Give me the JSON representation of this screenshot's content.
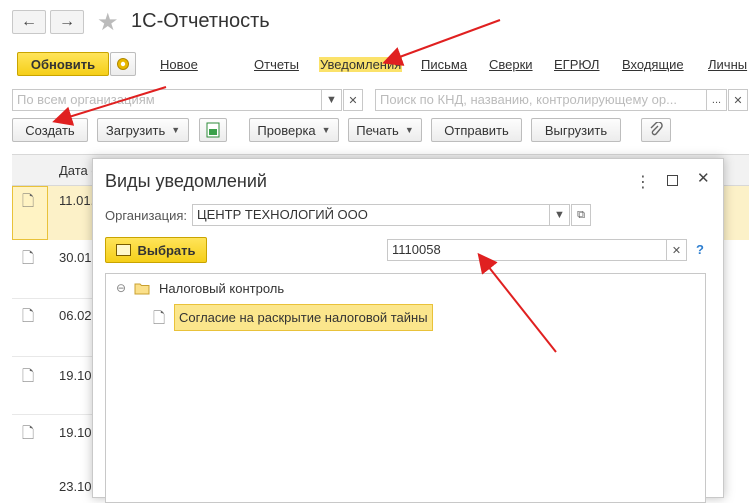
{
  "header": {
    "title": "1С-Отчетность",
    "back_icon": "←",
    "forward_icon": "→"
  },
  "toolbar1": {
    "refresh_label": "Обновить",
    "menu": [
      "Новое",
      "Отчеты",
      "Уведомления",
      "Письма",
      "Сверки",
      "ЕГРЮЛ",
      "Входящие",
      "Личны"
    ]
  },
  "filters": {
    "org_placeholder": "По всем организациям",
    "search_placeholder": "Поиск по КНД, названию, контролирующему ор..."
  },
  "toolbar2": {
    "create": "Создать",
    "load": "Загрузить",
    "check": "Проверка",
    "print": "Печать",
    "send": "Отправить",
    "unload": "Выгрузить"
  },
  "grid": {
    "date_header": "Дата о",
    "rows": [
      "11.01.",
      "30.01.",
      "06.02.",
      "19.10.",
      "19.10.",
      "23.10."
    ]
  },
  "modal": {
    "title": "Виды уведомлений",
    "org_label": "Организация:",
    "org_value": "ЦЕНТР ТЕХНОЛОГИЙ ООО",
    "select_button": "Выбрать",
    "search_value": "1110058",
    "help": "?",
    "tree_group": "Налоговый контроль",
    "tree_item": "Согласие на раскрытие налоговой тайны"
  },
  "colors": {
    "accent_yellow": "#f5cf19",
    "highlight": "#fcf1c8",
    "arrow_red": "#e02020"
  }
}
